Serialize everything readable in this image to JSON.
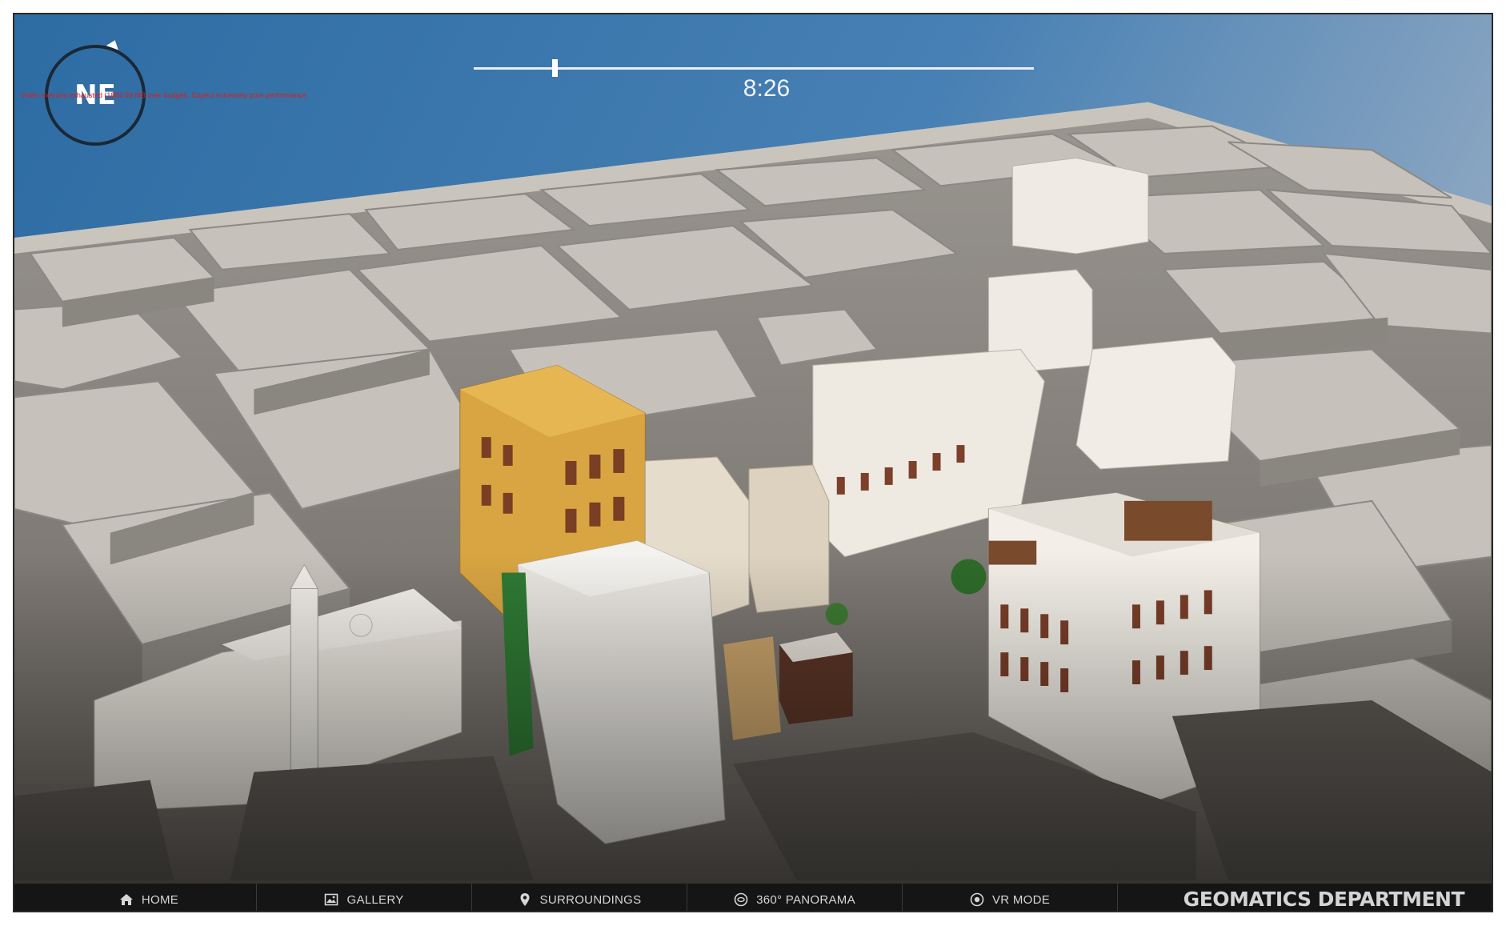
{
  "hud": {
    "compass_direction": "NE",
    "warning_text": "Video memory exhausted (1884.99 MB over budget). Expect extremely poor performance.",
    "time_label": "8:26",
    "time_position": 0.14
  },
  "nav": {
    "items": [
      {
        "label": "HOME",
        "icon": "home-icon"
      },
      {
        "label": "GALLERY",
        "icon": "image-icon"
      },
      {
        "label": "SURROUNDINGS",
        "icon": "map-pin-icon"
      },
      {
        "label": "360° PANORAMA",
        "icon": "panorama-icon"
      },
      {
        "label": "VR MODE",
        "icon": "vr-icon"
      }
    ],
    "brand": "GEOMATICS DEPARTMENT"
  },
  "colors": {
    "sky": "#3b74a8",
    "bar": "#151515",
    "warning": "#d81f1f"
  }
}
